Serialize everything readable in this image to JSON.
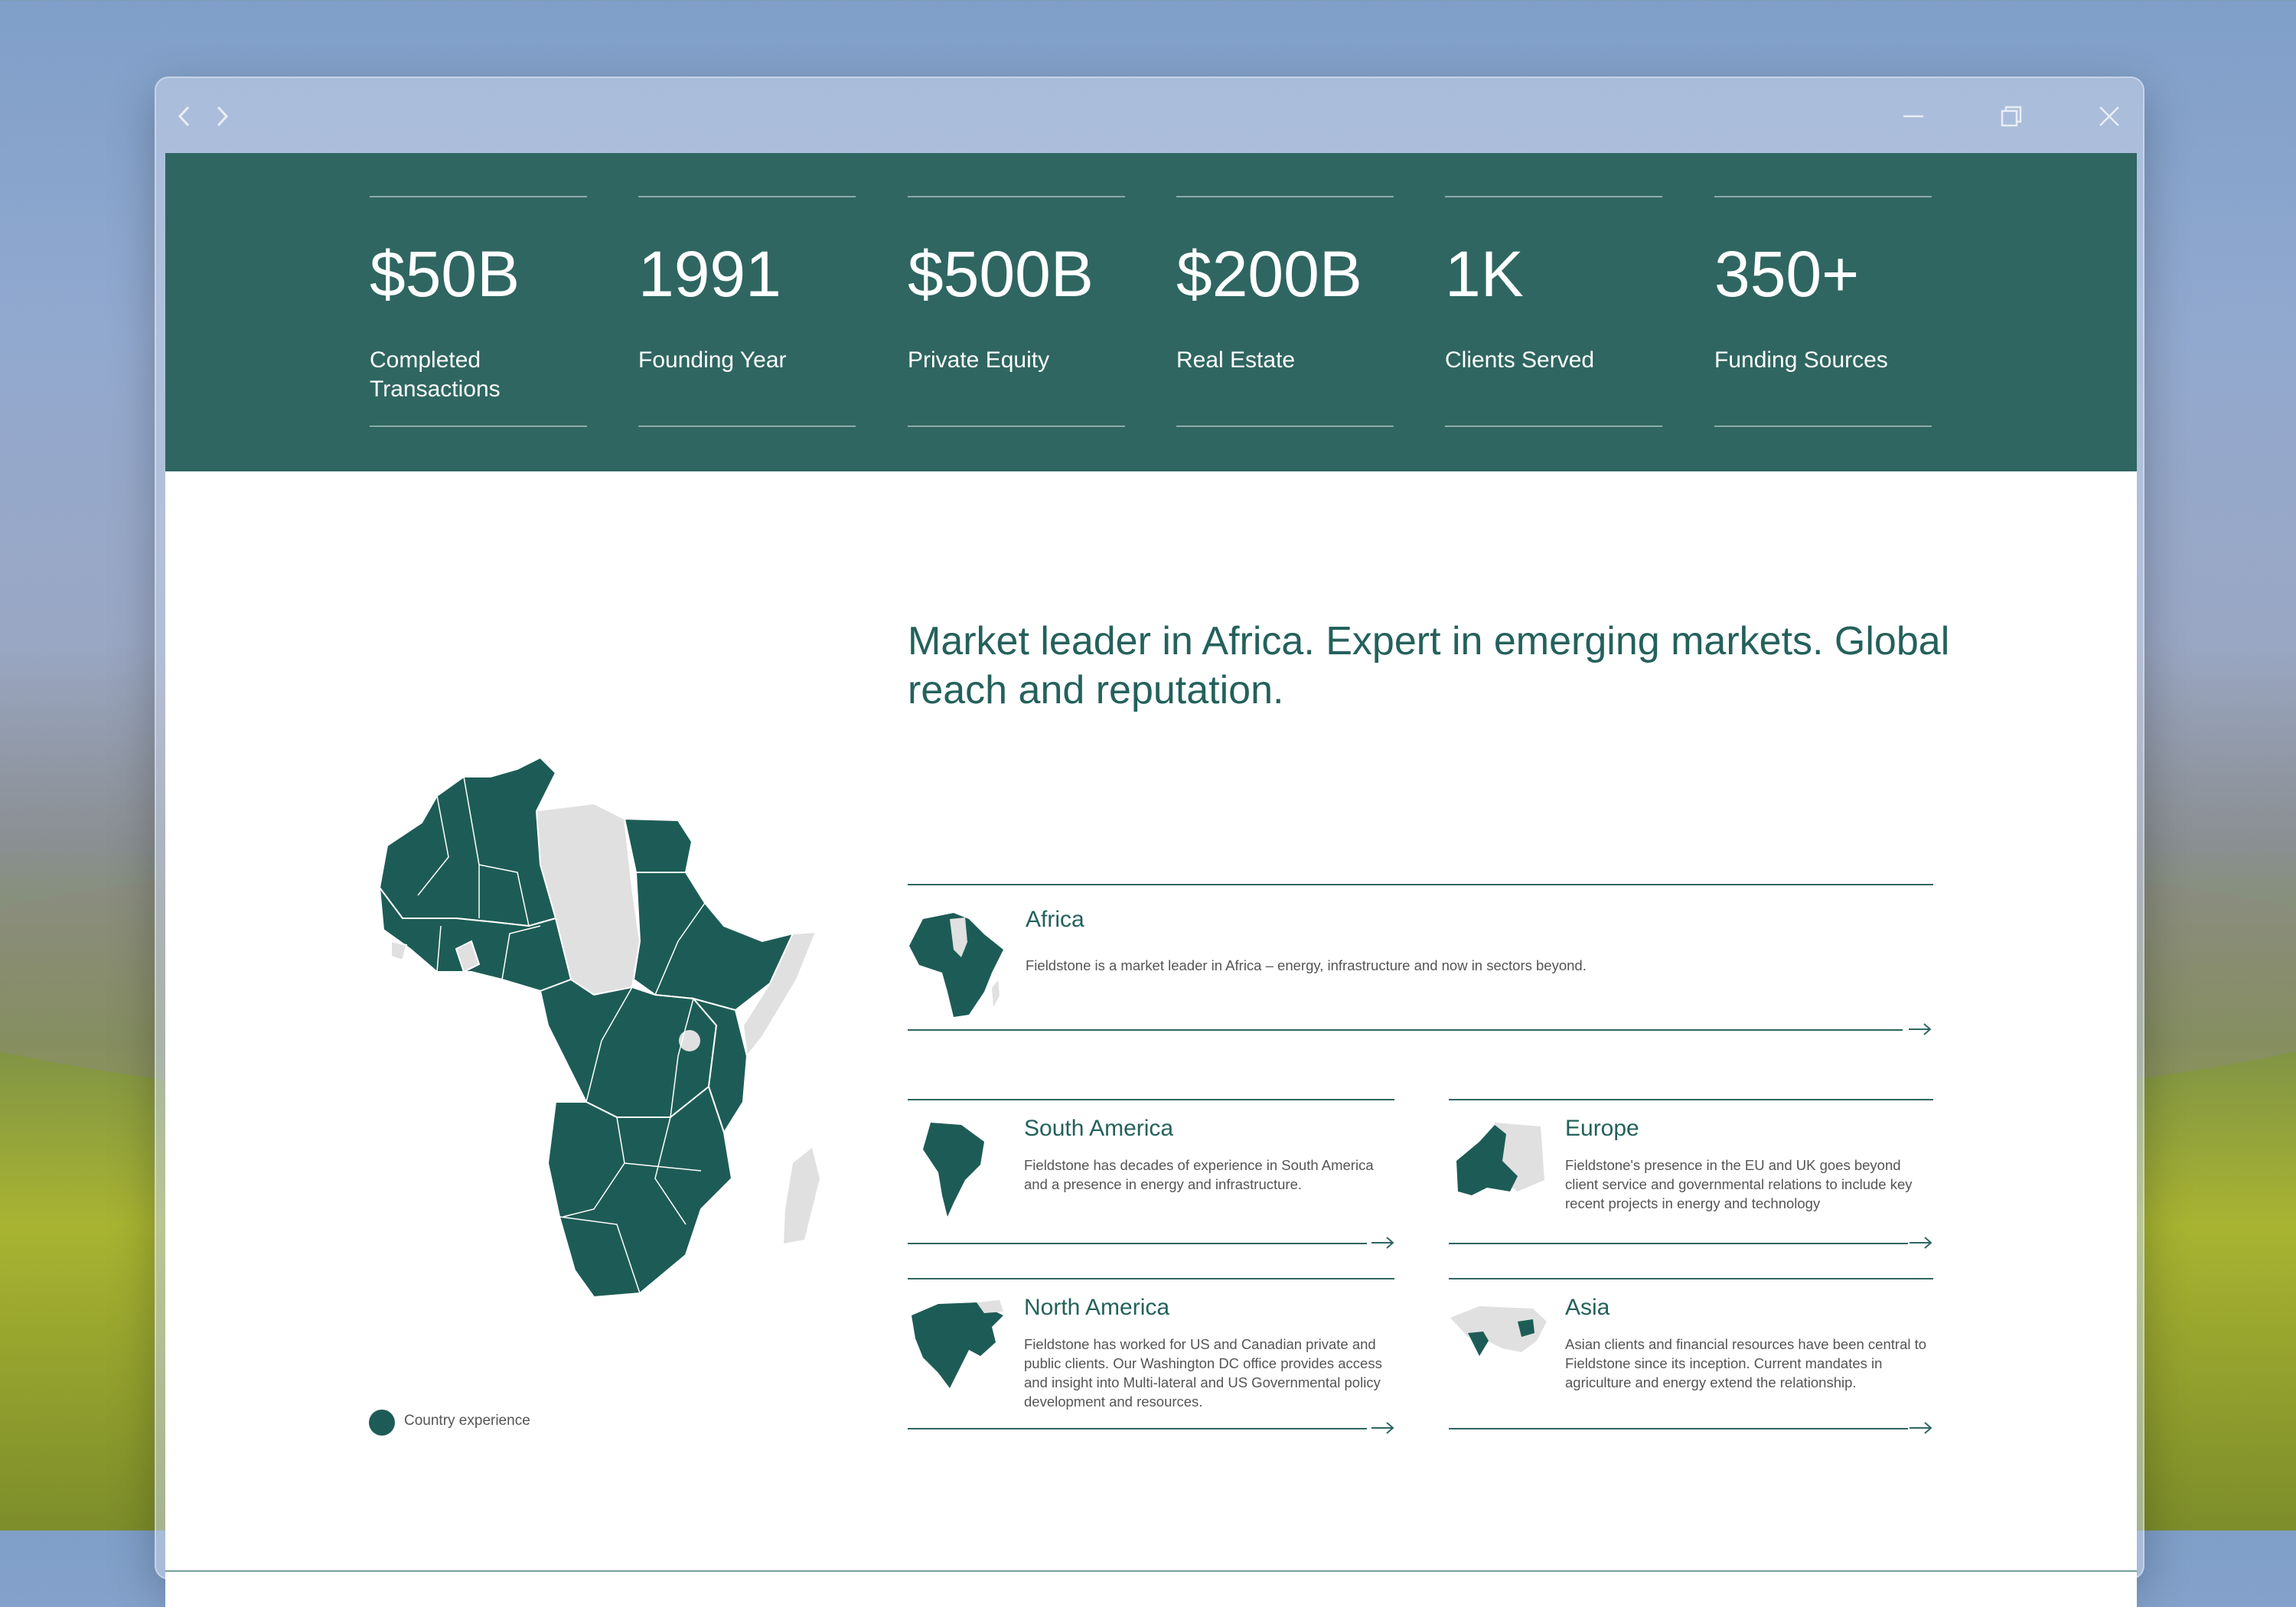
{
  "colors": {
    "brand": "#2f6661",
    "brand_dark": "#1d5c56",
    "map_grey": "#e0e0e0"
  },
  "titlebar": {
    "back_icon": "chevron-left-icon",
    "forward_icon": "chevron-right-icon",
    "minimize_icon": "minimize-icon",
    "restore_icon": "restore-icon",
    "close_icon": "close-icon"
  },
  "stats": [
    {
      "value": "$50B",
      "label": "Completed Transactions"
    },
    {
      "value": "1991",
      "label": "Founding Year"
    },
    {
      "value": "$500B",
      "label": "Private Equity"
    },
    {
      "value": "$200B",
      "label": "Real Estate"
    },
    {
      "value": "1K",
      "label": "Clients Served"
    },
    {
      "value": "350+",
      "label": "Funding Sources"
    }
  ],
  "headline": "Market leader in Africa. Expert in emerging markets. Global reach and reputation.",
  "legend": {
    "label": "Country experience"
  },
  "regions": {
    "africa": {
      "title": "Africa",
      "description": "Fieldstone is a market leader in Africa – energy, infrastructure and now in sectors beyond."
    },
    "south_america": {
      "title": "South America",
      "description": "Fieldstone has decades of experience in South America and a presence in energy and infrastructure."
    },
    "europe": {
      "title": "Europe",
      "description": "Fieldstone's presence in the EU and UK goes beyond client service and governmental relations to include key recent projects in energy and technology"
    },
    "north_america": {
      "title": "North America",
      "description": "Fieldstone has worked for US and Canadian private and public clients. Our Washington DC office provides access and insight into Multi-lateral and US Governmental policy development and resources."
    },
    "asia": {
      "title": "Asia",
      "description": "Asian clients and financial resources have been central to Fieldstone since its inception. Current mandates in agriculture and energy extend the relationship."
    }
  }
}
